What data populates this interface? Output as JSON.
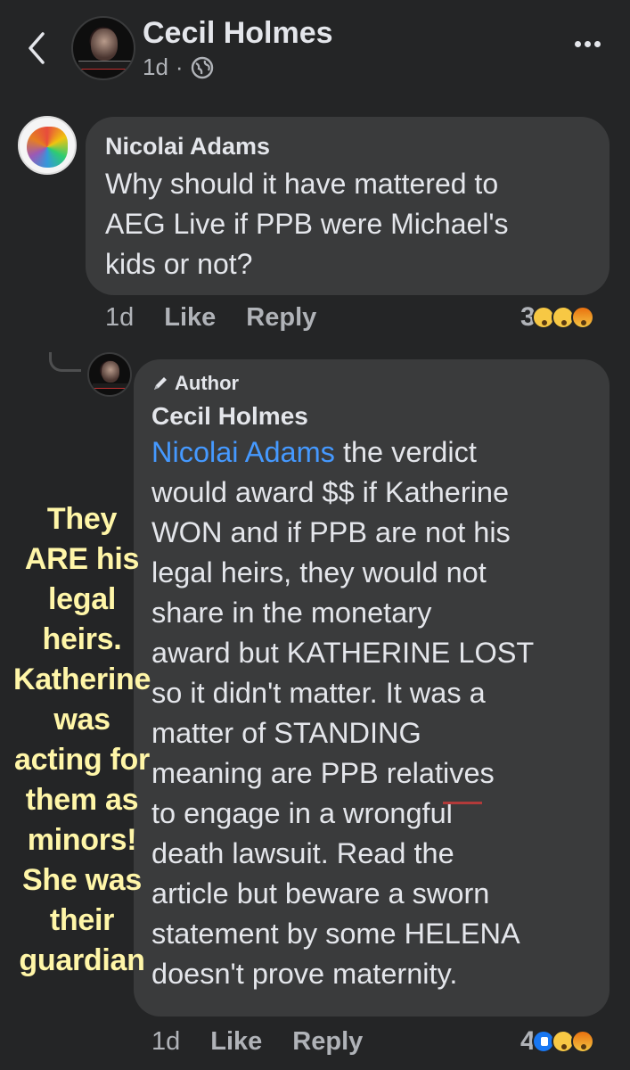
{
  "header": {
    "author": "Cecil Holmes",
    "time": "1d",
    "separator": "·"
  },
  "comment": {
    "author": "Nicolai Adams",
    "text": "Why should it have mattered to AEG Live if PPB were Michael's kids or not?",
    "lines": [
      "Why should it have mattered to",
      "AEG Live if PPB were Michael's",
      "kids or not?"
    ],
    "time": "1d",
    "like_label": "Like",
    "reply_label": "Reply",
    "reaction_count": "3",
    "reactions": [
      "wow",
      "sad",
      "angry"
    ]
  },
  "reply": {
    "badge": "Author",
    "author": "Cecil Holmes",
    "mention": "Nicolai Adams",
    "lines": [
      " the verdict",
      "would award $$ if Katherine",
      "WON and if PPB are not his",
      "legal heirs, they would not",
      "share in the monetary",
      "award but KATHERINE LOST",
      "so it didn't matter.  It was a",
      "matter of STANDING",
      "meaning are PPB relatives",
      "to engage in a wrongful",
      "death lawsuit.  Read the",
      "article but beware a sworn",
      "statement by some HELENA",
      "doesn't prove maternity."
    ],
    "time": "1d",
    "like_label": "Like",
    "reply_label": "Reply",
    "reaction_count": "4",
    "reactions": [
      "like",
      "wow",
      "angry"
    ]
  },
  "overlay_note": {
    "lines": [
      "They",
      "ARE his",
      "legal",
      "heirs.",
      "Katherine",
      "was",
      "acting for",
      "them as",
      "minors!",
      "She was",
      "their",
      "guardian"
    ],
    "color": "#fff6a8"
  },
  "colors": {
    "background": "#242526",
    "bubble": "#3a3b3c",
    "text": "#e4e6eb",
    "muted": "#b0b3b8",
    "mention": "#4599ff"
  },
  "icons": {
    "back": "chevron-left-icon",
    "audience": "globe-icon",
    "more": "more-dots-icon",
    "author_badge": "pen-icon"
  }
}
